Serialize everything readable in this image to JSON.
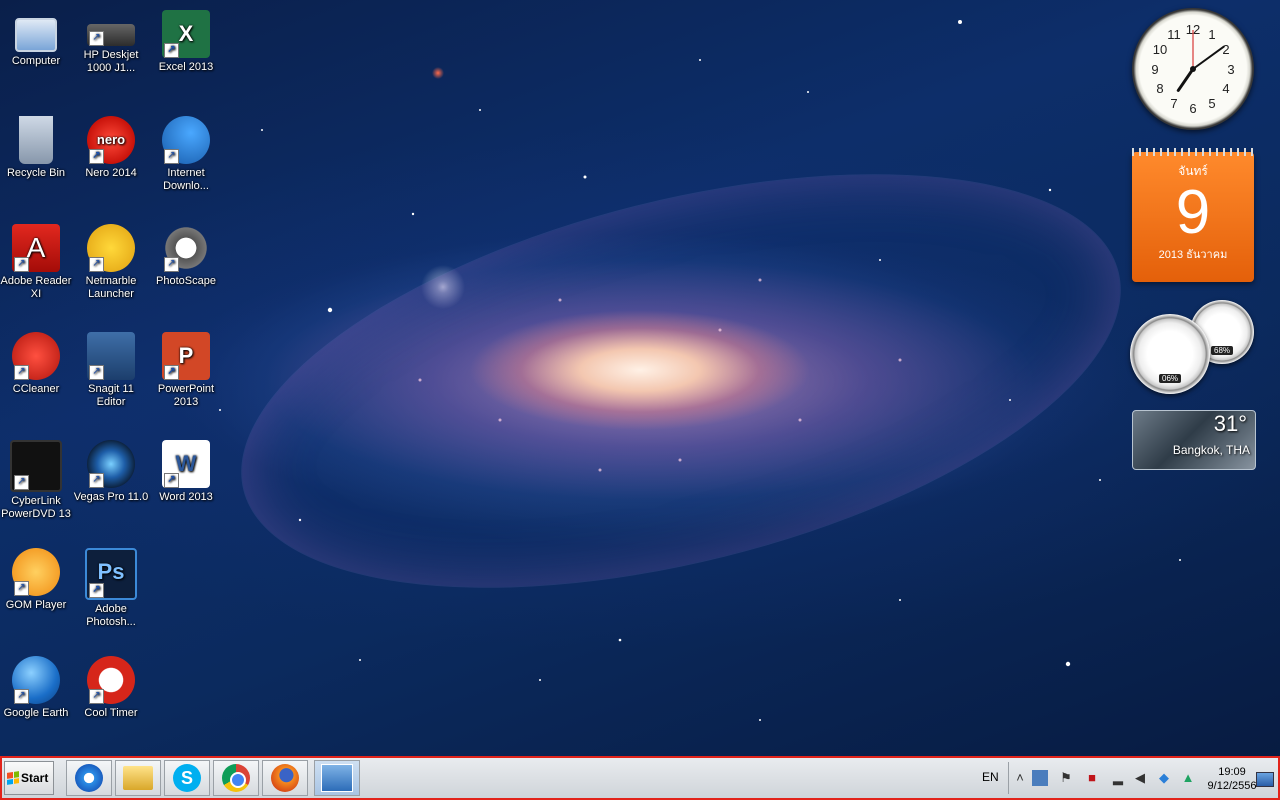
{
  "desktop": {
    "icons": [
      {
        "label": "Computer",
        "icon": "computer-icon"
      },
      {
        "label": "HP Deskjet 1000 J1...",
        "icon": "printer-icon"
      },
      {
        "label": "Excel 2013",
        "icon": "excel-icon"
      },
      {
        "label": "Recycle Bin",
        "icon": "recycle-bin-icon"
      },
      {
        "label": "Nero 2014",
        "icon": "nero-icon"
      },
      {
        "label": "Internet Downlo...",
        "icon": "internet-download-manager-icon"
      },
      {
        "label": "Adobe Reader XI",
        "icon": "adobe-reader-icon"
      },
      {
        "label": "Netmarble Launcher",
        "icon": "netmarble-icon"
      },
      {
        "label": "PhotoScape",
        "icon": "photoscape-icon"
      },
      {
        "label": "CCleaner",
        "icon": "ccleaner-icon"
      },
      {
        "label": "Snagit 11 Editor",
        "icon": "snagit-icon"
      },
      {
        "label": "PowerPoint 2013",
        "icon": "powerpoint-icon"
      },
      {
        "label": "CyberLink PowerDVD 13",
        "icon": "powerdvd-icon"
      },
      {
        "label": "Vegas Pro 11.0",
        "icon": "vegas-pro-icon"
      },
      {
        "label": "Word 2013",
        "icon": "word-icon"
      },
      {
        "label": "GOM Player",
        "icon": "gom-player-icon"
      },
      {
        "label": "Adobe Photosh...",
        "icon": "photoshop-icon"
      },
      {
        "label": "Google Earth",
        "icon": "google-earth-icon"
      },
      {
        "label": "Cool Timer",
        "icon": "cool-timer-icon"
      }
    ],
    "icon_glyphs": {
      "excel": "X",
      "word": "W",
      "powerpoint": "P",
      "photoshop": "Ps",
      "nero": "nero",
      "adobe_reader": "A"
    }
  },
  "gadgets": {
    "clock": {
      "time": "19:09",
      "numerals": [
        "12",
        "1",
        "2",
        "3",
        "4",
        "5",
        "6",
        "7",
        "8",
        "9",
        "10",
        "11"
      ]
    },
    "calendar": {
      "day_of_week": "จันทร์",
      "day": "9",
      "month_year": "2013 ธันวาคม"
    },
    "cpu_meter": {
      "cpu_percent": "06%",
      "memory_percent": "68%"
    },
    "weather": {
      "temperature": "31°",
      "city": "Bangkok, THA"
    }
  },
  "taskbar": {
    "start_label": "Start",
    "pinned": [
      {
        "name": "internet-explorer",
        "icon": "internet-explorer-icon"
      },
      {
        "name": "windows-explorer",
        "icon": "folder-icon"
      },
      {
        "name": "skype",
        "icon": "skype-icon"
      },
      {
        "name": "google-chrome",
        "icon": "chrome-icon"
      },
      {
        "name": "firefox",
        "icon": "firefox-icon"
      },
      {
        "name": "desktop-gadgets",
        "icon": "gadgets-icon"
      }
    ],
    "language": "EN",
    "tray": {
      "time": "19:09",
      "date": "9/12/2556"
    }
  }
}
